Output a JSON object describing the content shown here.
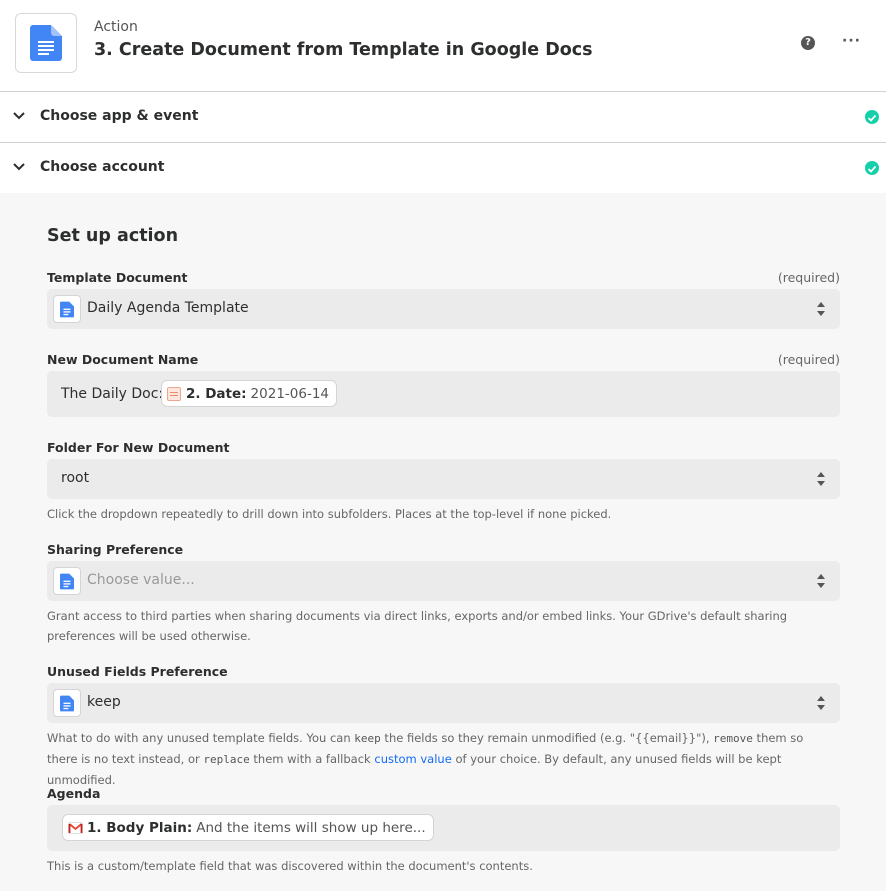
{
  "header": {
    "subtitle": "Action",
    "title": "3. Create Document from Template in Google Docs",
    "app_icon": "google-docs-icon",
    "help_icon": "question-circle-icon",
    "more_icon": "more-horizontal-icon",
    "help_symbol": "?",
    "more_symbol": "···"
  },
  "sections": [
    {
      "label": "Choose app & event",
      "status": "complete"
    },
    {
      "label": "Choose account",
      "status": "complete"
    }
  ],
  "setup": {
    "title": "Set up action",
    "fields": {
      "template_document": {
        "label": "Template Document",
        "required_text": "(required)",
        "value": "Daily Agenda Template"
      },
      "new_document_name": {
        "label": "New Document Name",
        "required_text": "(required)",
        "prefix": "The Daily Doc:",
        "pill_step": "2. Date:",
        "pill_value": "2021-06-14"
      },
      "folder": {
        "label": "Folder For New Document",
        "value": "root",
        "help": "Click the dropdown repeatedly to drill down into subfolders. Places at the top-level if none picked."
      },
      "sharing": {
        "label": "Sharing Preference",
        "placeholder": "Choose value...",
        "help": "Grant access to third parties when sharing documents via direct links, exports and/or embed links. Your GDrive's default sharing preferences will be used otherwise."
      },
      "unused_fields": {
        "label": "Unused Fields Preference",
        "value": "keep",
        "help_1": "What to do with any unused template fields. You can ",
        "code_keep": "keep",
        "help_2": " the fields so they remain unmodified (e.g. \"{{email}}\"), ",
        "code_remove": "remove",
        "help_3": " them so there is no text instead, or ",
        "code_replace": "replace",
        "help_4": " them with a fallback ",
        "help_link": "custom value",
        "help_5": " of your choice. By default, any unused fields will be kept unmodified."
      },
      "agenda": {
        "label": "Agenda",
        "pill_step": "1. Body Plain:",
        "pill_value": "And the items will show up here...",
        "help": "This is a custom/template field that was discovered within the document's contents."
      }
    }
  },
  "colors": {
    "success": "#13d0ab",
    "google_docs_blue": "#4285f4",
    "link": "#136bf5"
  }
}
